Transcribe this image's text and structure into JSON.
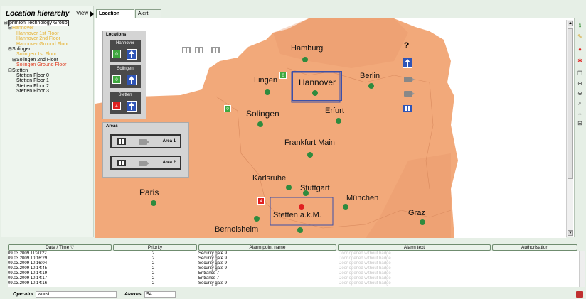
{
  "left_panel": {
    "title": "Location hierarchy",
    "view_label": "View",
    "tree": [
      {
        "label": "primion Technology Group",
        "toggle": "⊟",
        "indent": 0,
        "cls": "root"
      },
      {
        "label": "Hannover",
        "toggle": "⊟",
        "indent": 1,
        "cls": "yel"
      },
      {
        "label": "Hannover 1st Floor",
        "toggle": "",
        "indent": 2,
        "cls": "yel"
      },
      {
        "label": "Hannover 2nd Floor",
        "toggle": "",
        "indent": 2,
        "cls": "yel"
      },
      {
        "label": "Hannover Ground Floor",
        "toggle": "",
        "indent": 2,
        "cls": "yel"
      },
      {
        "label": "Solingen",
        "toggle": "⊟",
        "indent": 1,
        "cls": ""
      },
      {
        "label": "Solingen 1st Floor",
        "toggle": "",
        "indent": 2,
        "cls": "yel"
      },
      {
        "label": "Solingen 2nd Floor",
        "toggle": "⊞",
        "indent": 2,
        "cls": ""
      },
      {
        "label": "Solingen Ground Floor",
        "toggle": "",
        "indent": 2,
        "cls": "red"
      },
      {
        "label": "Stetten",
        "toggle": "⊟",
        "indent": 1,
        "cls": ""
      },
      {
        "label": "Stetten Floor 0",
        "toggle": "",
        "indent": 2,
        "cls": ""
      },
      {
        "label": "Stetten Floor 1",
        "toggle": "",
        "indent": 2,
        "cls": ""
      },
      {
        "label": "Stetten Floor 2",
        "toggle": "",
        "indent": 2,
        "cls": ""
      },
      {
        "label": "Stetten Floor 3",
        "toggle": "",
        "indent": 2,
        "cls": ""
      }
    ]
  },
  "tabs": [
    {
      "label": "Location graphic",
      "active": true
    },
    {
      "label": "Alert points",
      "active": false
    }
  ],
  "locations_panel": {
    "title": "Locations",
    "items": [
      {
        "name": "Hannover",
        "count": "0",
        "status_color": "#3fa83f"
      },
      {
        "name": "Solingen",
        "count": "0",
        "status_color": "#3fa83f"
      },
      {
        "name": "Stetten",
        "count": "4",
        "status_color": "#e02020"
      }
    ]
  },
  "areas_panel": {
    "title": "Areas",
    "items": [
      {
        "name": "Area 1"
      },
      {
        "name": "Area 2"
      }
    ]
  },
  "map": {
    "cities": [
      "Hamburg",
      "Lingen",
      "Hannover",
      "Berlin",
      "Solingen",
      "Erfurt",
      "Frankfurt Main",
      "Karlsruhe",
      "Stuttgart",
      "Paris",
      "München",
      "Stetten a.k.M.",
      "Graz",
      "Bernolsheim"
    ],
    "markers": [
      {
        "label": "0",
        "color": "#3fa83f"
      },
      {
        "label": "0",
        "color": "#3fa83f"
      },
      {
        "label": "4",
        "color": "#e02020"
      }
    ],
    "top_icons": [
      "door-icon",
      "door-icon",
      "door-icon"
    ]
  },
  "legend_icons": [
    "help-icon",
    "arrow-up-icon",
    "camera-icon",
    "camera-icon",
    "people-icon"
  ],
  "right_toolbar": [
    "info-icon",
    "edit-icon",
    "record-icon",
    "alarm-icon",
    "copy-icon",
    "zoom-in-icon",
    "zoom-out-icon",
    "search-icon",
    "fit-width-icon",
    "fit-page-icon"
  ],
  "alarm_table": {
    "columns": [
      "Date / Time",
      "Priority",
      "Alarm point name",
      "Alarm text",
      "Authorisation"
    ],
    "sort_indicator": "▽",
    "rows": [
      {
        "time": "09.03.2009 11:20:22",
        "priority": "2",
        "name": "Security gate 9",
        "text": "Door opened without badge",
        "auth": ""
      },
      {
        "time": "09.03.2009 10:16:29",
        "priority": "2",
        "name": "Security gate 9",
        "text": "Door opened without badge",
        "auth": ""
      },
      {
        "time": "09.03.2009 10:16:04",
        "priority": "2",
        "name": "Security gate 9",
        "text": "Door opened without badge",
        "auth": ""
      },
      {
        "time": "09.03.2009 10:14:45",
        "priority": "2",
        "name": "Security gate 9",
        "text": "Door opened without badge",
        "auth": ""
      },
      {
        "time": "09.03.2009 10:14:19",
        "priority": "2",
        "name": "Entrance 7",
        "text": "Door opened without badge",
        "auth": ""
      },
      {
        "time": "09.03.2009 10:14:17",
        "priority": "2",
        "name": "Entrance 7",
        "text": "Door opened without badge",
        "auth": ""
      },
      {
        "time": "09.03.2009 10:14:16",
        "priority": "2",
        "name": "Security gate 9",
        "text": "Door opened without badge",
        "auth": ""
      }
    ]
  },
  "status_bar": {
    "operator_label": "Operator:",
    "operator_value": "wurst",
    "alarms_label": "Alarms:",
    "alarms_value": "94"
  },
  "colors": {
    "land": "#f2a97a",
    "land_dark": "#e8956a",
    "water": "#ffffff",
    "dot": "#2e8b3e",
    "alert_dot": "#e02020",
    "rect": "#3c50a8"
  }
}
